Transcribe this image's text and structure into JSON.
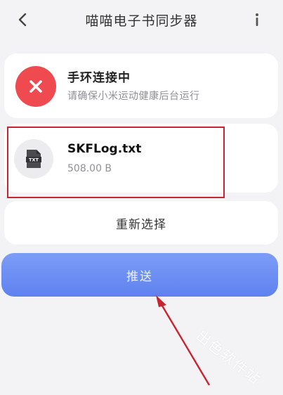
{
  "header": {
    "title": "喵喵电子书同步器",
    "back_icon": "chevron-left-icon",
    "info_icon": "info-icon"
  },
  "status": {
    "title": "手环连接中",
    "subtitle": "请确保小米运动健康后台运行",
    "icon": "close-circle-icon",
    "color": "#ef4a4f"
  },
  "file": {
    "name": "SKFLog.txt",
    "size": "508.00 B",
    "icon": "txt-file-icon",
    "icon_text": "TXT"
  },
  "actions": {
    "reselect_label": "重新选择",
    "push_label": "推送"
  },
  "annotation": {
    "highlight_color": "#c8242f",
    "arrow_color": "#c8242f"
  },
  "watermark": {
    "text": "出色软件站"
  }
}
